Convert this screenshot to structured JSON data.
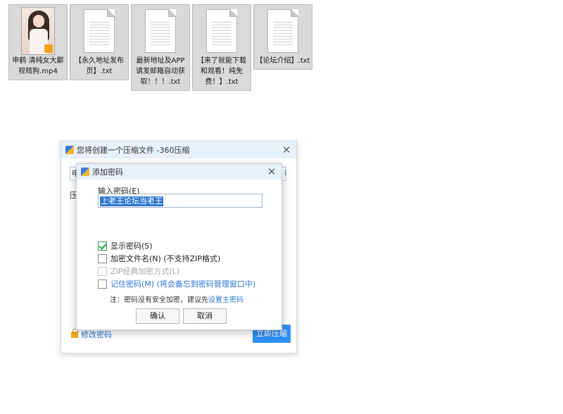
{
  "files": [
    {
      "name": "申鹤 清纯女大鄙视贱狗.mp4",
      "type": "video"
    },
    {
      "name": "【永久地址发布页】.txt",
      "type": "txt"
    },
    {
      "name": "最新地址及APP请发邮箱自动获取！！！.txt",
      "type": "txt"
    },
    {
      "name": "【来了就能下载和观看！纯免费！】.txt",
      "type": "txt"
    },
    {
      "name": "【论坛介绍】.txt",
      "type": "txt"
    }
  ],
  "back_dialog": {
    "title": "您将创建一个压缩文件 -360压缩",
    "field_value": "申",
    "field_button": "i",
    "label": "压",
    "modify_password_link": "修改密码",
    "compress_button": "立即压缩"
  },
  "password_dialog": {
    "title": "添加密码",
    "input_label": "输入密码(E)",
    "password_value": "上老王论坛当老王",
    "options": [
      {
        "label": "显示密码(S)",
        "checked": true
      },
      {
        "label": "加密文件名(N) (不支持ZIP格式)",
        "checked": false
      },
      {
        "label": "ZIP经典加密方式(L)",
        "checked": false
      },
      {
        "label": "记住密码(M) (将会备忘到密码管理窗口中)",
        "checked": false
      }
    ],
    "note_prefix": "注：密码没有安全加密，建议先",
    "note_link": "设置主密码",
    "ok_button": "确认",
    "cancel_button": "取消"
  },
  "colors": {
    "accent": "#2f8ff0",
    "link": "#2b77d8",
    "titlebar": "#e8f0fa"
  }
}
